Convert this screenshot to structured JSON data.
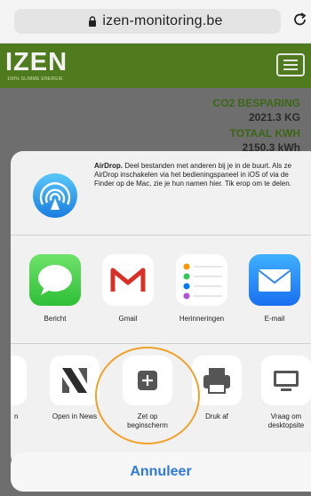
{
  "browser": {
    "url": "izen-monitoring.be"
  },
  "site": {
    "logo": "IZEN",
    "logo_subtitle": "100% SLIMME ENERGIE",
    "stats": [
      {
        "label": "CO2 BESPARING",
        "value": "2021.3 KG"
      },
      {
        "label": "TOTAAL KWH",
        "value": "2150.3 kWh"
      }
    ]
  },
  "share_sheet": {
    "airdrop_title": "AirDrop.",
    "airdrop_text": "Deel bestanden met anderen bij je in de buurt. Als ze AirDrop inschakelen via het bedieningspaneel in iOS of via de Finder op de Mac, zie je hun namen hier. Tik erop om te delen.",
    "apps": [
      {
        "label": "Bericht",
        "icon": "messages-icon"
      },
      {
        "label": "Gmail",
        "icon": "gmail-icon"
      },
      {
        "label": "Herinneringen",
        "icon": "reminders-icon"
      },
      {
        "label": "E-mail",
        "icon": "mail-icon"
      }
    ],
    "actions": [
      {
        "label": "n",
        "icon": "partial-action-icon"
      },
      {
        "label": "Open in News",
        "icon": "news-icon"
      },
      {
        "label": "Zet op beginscherm",
        "icon": "add-to-home-icon"
      },
      {
        "label": "Druk af",
        "icon": "print-icon"
      },
      {
        "label": "Vraag om desktopsite",
        "icon": "desktop-icon"
      }
    ],
    "cancel_label": "Annuleer"
  },
  "colors": {
    "site_green": "#4f7a1e",
    "accent_blue": "#2f7bd6",
    "highlight_orange": "#f0a12a"
  }
}
